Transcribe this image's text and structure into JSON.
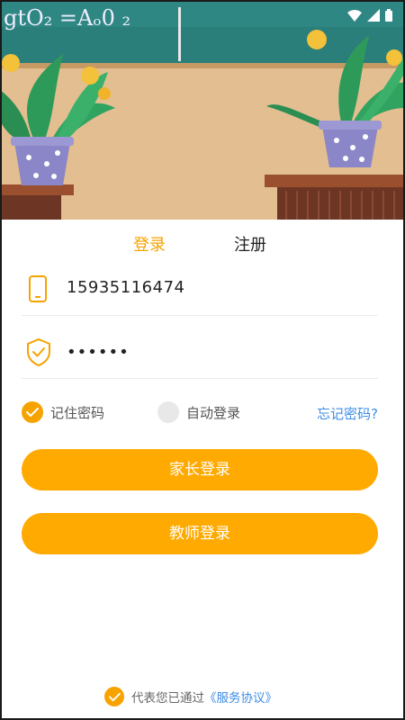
{
  "chalkboard_text": "gtO₂ =Aₒ0 ₂",
  "tabs": {
    "login": "登录",
    "register": "注册"
  },
  "phone": {
    "icon": "phone-icon",
    "value": "15935116474"
  },
  "password": {
    "icon": "shield-check-icon",
    "value": "••••••"
  },
  "options": {
    "remember": "记住密码",
    "remember_checked": true,
    "auto_login": "自动登录",
    "auto_login_checked": false,
    "forgot": "忘记密码?"
  },
  "buttons": {
    "parent": "家长登录",
    "teacher": "教师登录"
  },
  "agreement": {
    "prefix": "代表您已通过",
    "link": "《服务协议》",
    "checked": true
  },
  "colors": {
    "accent": "#ffaa00",
    "link": "#3d8ce6",
    "board": "#2e8380"
  }
}
